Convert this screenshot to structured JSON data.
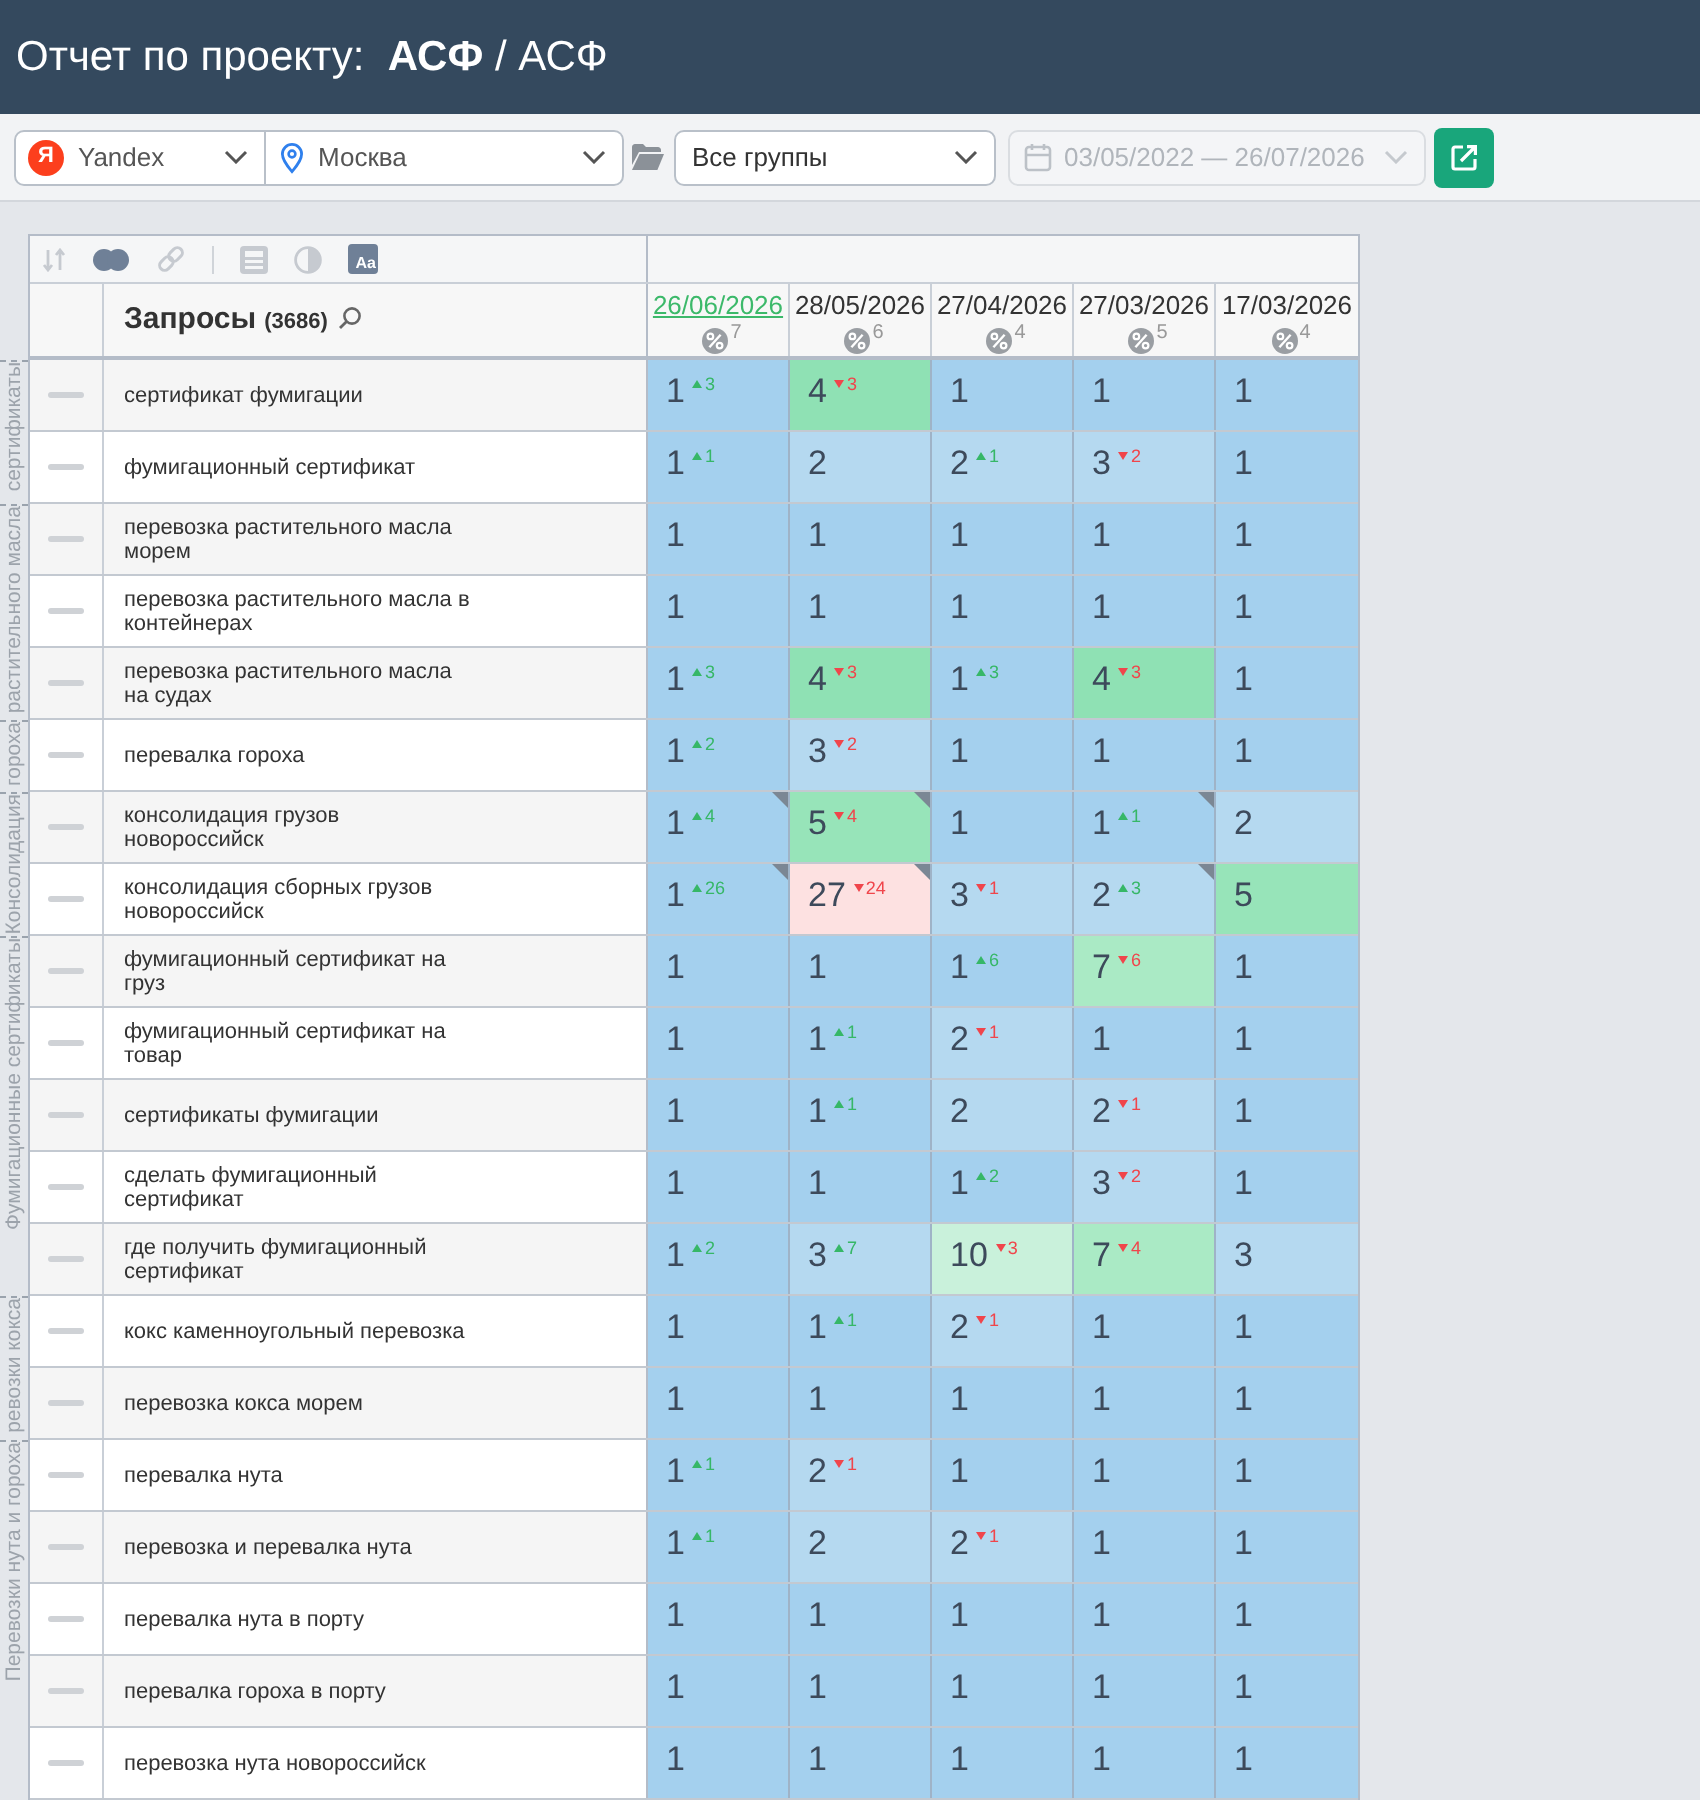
{
  "header": {
    "title": "Отчет по проекту:  **АСФ** / АСФ"
  },
  "filters": {
    "engine": {
      "logo": "Я",
      "label": "Yandex"
    },
    "region": {
      "label": "Москва"
    },
    "group": {
      "label": "Все группы"
    },
    "dates": {
      "label": "03/05/2022 — 26/07/2026",
      "disabled": true
    }
  },
  "table": {
    "tools": [
      {
        "kind": "sort",
        "active": false
      },
      {
        "kind": "circles",
        "active": true
      },
      {
        "kind": "link",
        "active": false
      },
      {
        "kind": "separator"
      },
      {
        "kind": "calculator",
        "active": false
      },
      {
        "kind": "contrast",
        "active": false
      },
      {
        "kind": "font",
        "label": "Aa",
        "active": true
      }
    ],
    "query_header": {
      "label": "Запросы",
      "count": "(3686)"
    },
    "columns": [
      {
        "date": "26/06/2026",
        "selected": true,
        "count": "7"
      },
      {
        "date": "28/05/2026",
        "selected": false,
        "count": "6"
      },
      {
        "date": "27/04/2026",
        "selected": false,
        "count": "4"
      },
      {
        "date": "27/03/2026",
        "selected": false,
        "count": "5"
      },
      {
        "date": "17/03/2026",
        "selected": false,
        "count": "4"
      }
    ],
    "groups": [
      {
        "label": "сертификаты",
        "rows": [
          {
            "query": "сертификат фумигации",
            "cells": [
              {
                "value": "1",
                "change": {
                  "text": "3",
                  "up": true
                },
                "color": "#a4d0ee",
                "marked": false
              },
              {
                "value": "4",
                "change": {
                  "text": "3",
                  "up": false
                },
                "color": "#8fe1b4",
                "marked": false
              },
              {
                "value": "1",
                "color": "#a4d0ee",
                "marked": false
              },
              {
                "value": "1",
                "color": "#a4d0ee",
                "marked": false
              },
              {
                "value": "1",
                "color": "#a4d0ee",
                "marked": false
              }
            ]
          },
          {
            "query": "фумигационный сертификат",
            "cells": [
              {
                "value": "1",
                "change": {
                  "text": "1",
                  "up": true
                },
                "color": "#a4d0ee",
                "marked": false
              },
              {
                "value": "2",
                "color": "#b5d9f0",
                "marked": false
              },
              {
                "value": "2",
                "change": {
                  "text": "1",
                  "up": true
                },
                "color": "#b5d9f0",
                "marked": false
              },
              {
                "value": "3",
                "change": {
                  "text": "2",
                  "up": false
                },
                "color": "#b5d9f0",
                "marked": false
              },
              {
                "value": "1",
                "color": "#a4d0ee",
                "marked": false
              }
            ]
          }
        ]
      },
      {
        "label": "растительного масла",
        "rows": [
          {
            "query": "перевозка растительного масла морем",
            "cells": [
              {
                "value": "1",
                "color": "#a4d0ee",
                "marked": false
              },
              {
                "value": "1",
                "color": "#a4d0ee",
                "marked": false
              },
              {
                "value": "1",
                "color": "#a4d0ee",
                "marked": false
              },
              {
                "value": "1",
                "color": "#a4d0ee",
                "marked": false
              },
              {
                "value": "1",
                "color": "#a4d0ee",
                "marked": false
              }
            ]
          },
          {
            "query": "перевозка растительного масла в контейнерах",
            "cells": [
              {
                "value": "1",
                "color": "#a4d0ee",
                "marked": false
              },
              {
                "value": "1",
                "color": "#a4d0ee",
                "marked": false
              },
              {
                "value": "1",
                "color": "#a4d0ee",
                "marked": false
              },
              {
                "value": "1",
                "color": "#a4d0ee",
                "marked": false
              },
              {
                "value": "1",
                "color": "#a4d0ee",
                "marked": false
              }
            ]
          },
          {
            "query": "перевозка растительного масла на судах",
            "cells": [
              {
                "value": "1",
                "change": {
                  "text": "3",
                  "up": true
                },
                "color": "#a4d0ee",
                "marked": false
              },
              {
                "value": "4",
                "change": {
                  "text": "3",
                  "up": false
                },
                "color": "#8fe1b4",
                "marked": false
              },
              {
                "value": "1",
                "change": {
                  "text": "3",
                  "up": true
                },
                "color": "#a4d0ee",
                "marked": false
              },
              {
                "value": "4",
                "change": {
                  "text": "3",
                  "up": false
                },
                "color": "#8fe1b4",
                "marked": false
              },
              {
                "value": "1",
                "color": "#a4d0ee",
                "marked": false
              }
            ]
          }
        ]
      },
      {
        "label": "гороха",
        "rows": [
          {
            "query": "перевалка гороха",
            "cells": [
              {
                "value": "1",
                "change": {
                  "text": "2",
                  "up": true
                },
                "color": "#a4d0ee",
                "marked": false
              },
              {
                "value": "3",
                "change": {
                  "text": "2",
                  "up": false
                },
                "color": "#b5d9f0",
                "marked": false
              },
              {
                "value": "1",
                "color": "#a4d0ee",
                "marked": false
              },
              {
                "value": "1",
                "color": "#a4d0ee",
                "marked": false
              },
              {
                "value": "1",
                "color": "#a4d0ee",
                "marked": false
              }
            ]
          }
        ]
      },
      {
        "label": "Консолидация",
        "rows": [
          {
            "query": "консолидация грузов новороссийск",
            "cells": [
              {
                "value": "1",
                "change": {
                  "text": "4",
                  "up": true
                },
                "color": "#a4d0ee",
                "marked": true
              },
              {
                "value": "5",
                "change": {
                  "text": "4",
                  "up": false
                },
                "color": "#97e4b9",
                "marked": true
              },
              {
                "value": "1",
                "color": "#a4d0ee",
                "marked": false
              },
              {
                "value": "1",
                "change": {
                  "text": "1",
                  "up": true
                },
                "color": "#a4d0ee",
                "marked": true
              },
              {
                "value": "2",
                "color": "#b5d9f0",
                "marked": false
              }
            ]
          },
          {
            "query": "консолидация сборных грузов новороссийск",
            "cells": [
              {
                "value": "1",
                "change": {
                  "text": "26",
                  "up": true
                },
                "color": "#a4d0ee",
                "marked": true
              },
              {
                "value": "27",
                "change": {
                  "text": "24",
                  "up": false
                },
                "color": "#fde1e1",
                "marked": true
              },
              {
                "value": "3",
                "change": {
                  "text": "1",
                  "up": false
                },
                "color": "#b5d9f0",
                "marked": false
              },
              {
                "value": "2",
                "change": {
                  "text": "3",
                  "up": true
                },
                "color": "#b5d9f0",
                "marked": true
              },
              {
                "value": "5",
                "color": "#97e4b9",
                "marked": false
              }
            ]
          }
        ]
      },
      {
        "label": "Фумигационные сертификаты",
        "rows": [
          {
            "query": "фумигационный сертификат на груз",
            "cells": [
              {
                "value": "1",
                "color": "#a4d0ee",
                "marked": false
              },
              {
                "value": "1",
                "color": "#a4d0ee",
                "marked": false
              },
              {
                "value": "1",
                "change": {
                  "text": "6",
                  "up": true
                },
                "color": "#a4d0ee",
                "marked": false
              },
              {
                "value": "7",
                "change": {
                  "text": "6",
                  "up": false
                },
                "color": "#aaeac5",
                "marked": false
              },
              {
                "value": "1",
                "color": "#a4d0ee",
                "marked": false
              }
            ]
          },
          {
            "query": "фумигационный сертификат на товар",
            "cells": [
              {
                "value": "1",
                "color": "#a4d0ee",
                "marked": false
              },
              {
                "value": "1",
                "change": {
                  "text": "1",
                  "up": true
                },
                "color": "#a4d0ee",
                "marked": false
              },
              {
                "value": "2",
                "change": {
                  "text": "1",
                  "up": false
                },
                "color": "#b5d9f0",
                "marked": false
              },
              {
                "value": "1",
                "color": "#a4d0ee",
                "marked": false
              },
              {
                "value": "1",
                "color": "#a4d0ee",
                "marked": false
              }
            ]
          },
          {
            "query": "сертификаты фумигации",
            "cells": [
              {
                "value": "1",
                "color": "#a4d0ee",
                "marked": false
              },
              {
                "value": "1",
                "change": {
                  "text": "1",
                  "up": true
                },
                "color": "#a4d0ee",
                "marked": false
              },
              {
                "value": "2",
                "color": "#b5d9f0",
                "marked": false
              },
              {
                "value": "2",
                "change": {
                  "text": "1",
                  "up": false
                },
                "color": "#b5d9f0",
                "marked": false
              },
              {
                "value": "1",
                "color": "#a4d0ee",
                "marked": false
              }
            ]
          },
          {
            "query": "сделать фумигационный сертификат",
            "cells": [
              {
                "value": "1",
                "color": "#a4d0ee",
                "marked": false
              },
              {
                "value": "1",
                "color": "#a4d0ee",
                "marked": false
              },
              {
                "value": "1",
                "change": {
                  "text": "2",
                  "up": true
                },
                "color": "#a4d0ee",
                "marked": false
              },
              {
                "value": "3",
                "change": {
                  "text": "2",
                  "up": false
                },
                "color": "#b5d9f0",
                "marked": false
              },
              {
                "value": "1",
                "color": "#a4d0ee",
                "marked": false
              }
            ]
          },
          {
            "query": "где получить фумигационный сертификат",
            "cells": [
              {
                "value": "1",
                "change": {
                  "text": "2",
                  "up": true
                },
                "color": "#a4d0ee",
                "marked": false
              },
              {
                "value": "3",
                "change": {
                  "text": "7",
                  "up": true
                },
                "color": "#b5d9f0",
                "marked": false
              },
              {
                "value": "10",
                "change": {
                  "text": "3",
                  "up": false
                },
                "color": "#c9f1db",
                "marked": false
              },
              {
                "value": "7",
                "change": {
                  "text": "4",
                  "up": false
                },
                "color": "#aaeac5",
                "marked": false
              },
              {
                "value": "3",
                "color": "#b5d9f0",
                "marked": false
              }
            ]
          }
        ]
      },
      {
        "label": "ревозки кокса",
        "rows": [
          {
            "query": "кокс каменноугольный перевозка",
            "cells": [
              {
                "value": "1",
                "color": "#a4d0ee",
                "marked": false
              },
              {
                "value": "1",
                "change": {
                  "text": "1",
                  "up": true
                },
                "color": "#a4d0ee",
                "marked": false
              },
              {
                "value": "2",
                "change": {
                  "text": "1",
                  "up": false
                },
                "color": "#b5d9f0",
                "marked": false
              },
              {
                "value": "1",
                "color": "#a4d0ee",
                "marked": false
              },
              {
                "value": "1",
                "color": "#a4d0ee",
                "marked": false
              }
            ]
          },
          {
            "query": "перевозка кокса морем",
            "cells": [
              {
                "value": "1",
                "color": "#a4d0ee",
                "marked": false
              },
              {
                "value": "1",
                "color": "#a4d0ee",
                "marked": false
              },
              {
                "value": "1",
                "color": "#a4d0ee",
                "marked": false
              },
              {
                "value": "1",
                "color": "#a4d0ee",
                "marked": false
              },
              {
                "value": "1",
                "color": "#a4d0ee",
                "marked": false
              }
            ]
          }
        ]
      },
      {
        "label": "Перевозки нута и гороха",
        "rows": [
          {
            "query": "перевалка нута",
            "cells": [
              {
                "value": "1",
                "change": {
                  "text": "1",
                  "up": true
                },
                "color": "#a4d0ee",
                "marked": false
              },
              {
                "value": "2",
                "change": {
                  "text": "1",
                  "up": false
                },
                "color": "#b5d9f0",
                "marked": false
              },
              {
                "value": "1",
                "color": "#a4d0ee",
                "marked": false
              },
              {
                "value": "1",
                "color": "#a4d0ee",
                "marked": false
              },
              {
                "value": "1",
                "color": "#a4d0ee",
                "marked": false
              }
            ]
          },
          {
            "query": "перевозка и перевалка нута",
            "cells": [
              {
                "value": "1",
                "change": {
                  "text": "1",
                  "up": true
                },
                "color": "#a4d0ee",
                "marked": false
              },
              {
                "value": "2",
                "color": "#b5d9f0",
                "marked": false
              },
              {
                "value": "2",
                "change": {
                  "text": "1",
                  "up": false
                },
                "color": "#b5d9f0",
                "marked": false
              },
              {
                "value": "1",
                "color": "#a4d0ee",
                "marked": false
              },
              {
                "value": "1",
                "color": "#a4d0ee",
                "marked": false
              }
            ]
          },
          {
            "query": "перевалка нута в порту",
            "cells": [
              {
                "value": "1",
                "color": "#a4d0ee",
                "marked": false
              },
              {
                "value": "1",
                "color": "#a4d0ee",
                "marked": false
              },
              {
                "value": "1",
                "color": "#a4d0ee",
                "marked": false
              },
              {
                "value": "1",
                "color": "#a4d0ee",
                "marked": false
              },
              {
                "value": "1",
                "color": "#a4d0ee",
                "marked": false
              }
            ]
          },
          {
            "query": "перевалка гороха в порту",
            "cells": [
              {
                "value": "1",
                "color": "#a4d0ee",
                "marked": false
              },
              {
                "value": "1",
                "color": "#a4d0ee",
                "marked": false
              },
              {
                "value": "1",
                "color": "#a4d0ee",
                "marked": false
              },
              {
                "value": "1",
                "color": "#a4d0ee",
                "marked": false
              },
              {
                "value": "1",
                "color": "#a4d0ee",
                "marked": false
              }
            ]
          },
          {
            "query": "перевозка нута новороссийск",
            "cells": [
              {
                "value": "1",
                "color": "#a4d0ee",
                "marked": false
              },
              {
                "value": "1",
                "color": "#a4d0ee",
                "marked": false
              },
              {
                "value": "1",
                "color": "#a4d0ee",
                "marked": false
              },
              {
                "value": "1",
                "color": "#a4d0ee",
                "marked": false
              },
              {
                "value": "1",
                "color": "#a4d0ee",
                "marked": false
              }
            ]
          }
        ]
      }
    ]
  }
}
